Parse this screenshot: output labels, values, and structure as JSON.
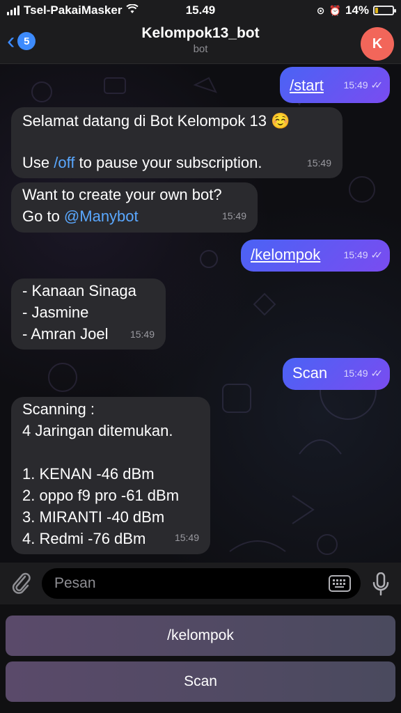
{
  "status_bar": {
    "carrier": "Tsel-PakaiMasker",
    "time": "15.49",
    "battery": "14%",
    "battery_level": 0.14
  },
  "header": {
    "back_count": "5",
    "title": "Kelompok13_bot",
    "subtitle": "bot",
    "avatar_letter": "K",
    "avatar_color": "#f2665a"
  },
  "messages": [
    {
      "direction": "out",
      "text": "/start",
      "time": "15:49"
    },
    {
      "direction": "in",
      "line1": "Selamat datang di Bot Kelompok 13 ☺️",
      "line2_pre": "Use ",
      "line2_link": "/off",
      "line2_post": " to pause your subscription.",
      "time": "15:49"
    },
    {
      "direction": "in",
      "line1": "Want to create your own bot?",
      "line2_pre": "Go to ",
      "line2_link": "@Manybot",
      "time": "15:49"
    },
    {
      "direction": "out",
      "text": "/kelompok",
      "time": "15:49"
    },
    {
      "direction": "in",
      "lines": [
        "- Kanaan Sinaga",
        "- Jasmine",
        "- Amran Joel"
      ],
      "time": "15:49"
    },
    {
      "direction": "out",
      "text": "Scan",
      "time": "15:49"
    },
    {
      "direction": "in",
      "lines": [
        "Scanning :",
        "4 Jaringan ditemukan.",
        "",
        "1. KENAN -46 dBm",
        "2. oppo f9 pro -61 dBm",
        "3. MIRANTI -40 dBm",
        "4. Redmi -76 dBm"
      ],
      "time": "15:49"
    }
  ],
  "input": {
    "placeholder": "Pesan"
  },
  "keyboard": {
    "buttons": [
      "/kelompok",
      "Scan"
    ]
  },
  "colors": {
    "accent": "#3d8bfd",
    "outgoing_start": "#4a63f5",
    "outgoing_end": "#7a4cf0",
    "incoming": "#2a2a2e",
    "link": "#5aa8ff"
  }
}
